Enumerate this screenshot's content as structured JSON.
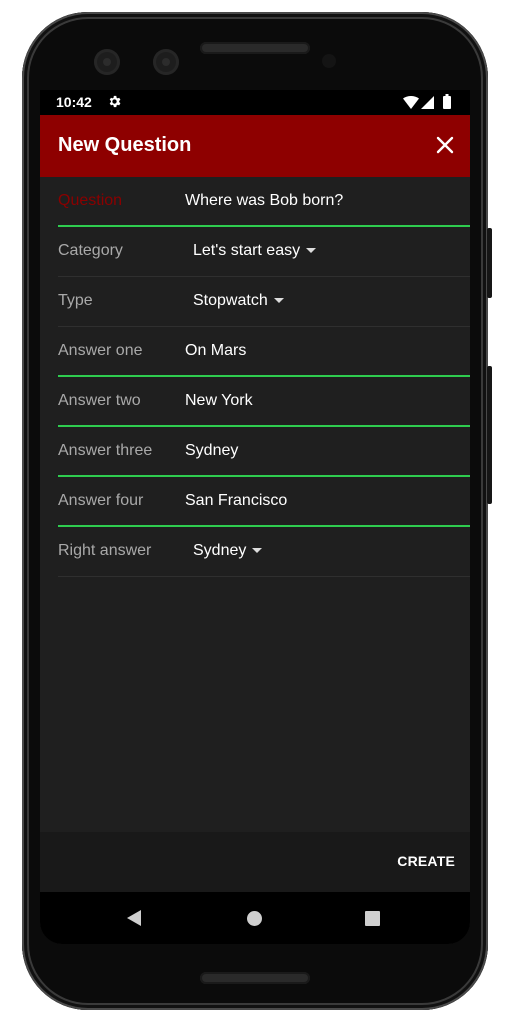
{
  "status_bar": {
    "time": "10:42"
  },
  "app_bar": {
    "title": "New Question"
  },
  "form": {
    "question": {
      "label": "Question",
      "value": "Where was Bob born?"
    },
    "category": {
      "label": "Category",
      "value": "Let's start easy"
    },
    "type": {
      "label": "Type",
      "value": "Stopwatch"
    },
    "answer_one": {
      "label": "Answer one",
      "value": "On Mars"
    },
    "answer_two": {
      "label": "Answer two",
      "value": "New York"
    },
    "answer_three": {
      "label": "Answer three",
      "value": "Sydney"
    },
    "answer_four": {
      "label": "Answer four",
      "value": "San Francisco"
    },
    "right_answer": {
      "label": "Right answer",
      "value": "Sydney"
    }
  },
  "footer": {
    "create_label": "CREATE"
  },
  "colors": {
    "app_bar": "#8e0000",
    "underline": "#2ecc4f",
    "focused_label": "#8b0000",
    "background": "#1f1f1f"
  },
  "icons": [
    "gear-icon",
    "wifi-icon",
    "signal-icon",
    "battery-icon",
    "close-icon",
    "back-icon",
    "home-icon",
    "recents-icon",
    "chevron-down-icon"
  ]
}
